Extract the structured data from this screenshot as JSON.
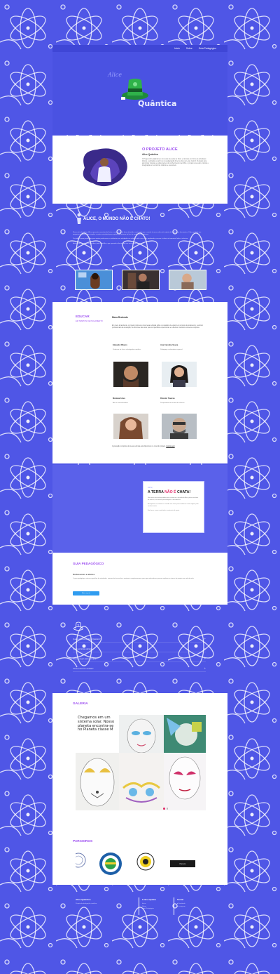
{
  "nav": {
    "items": [
      "Início",
      "Sobre",
      "Guia Pedagógico"
    ]
  },
  "hero": {
    "logo_alice": "Alice",
    "logo_quantica": "Quântica"
  },
  "projeto": {
    "title": "O PROJETO ALICE",
    "subtitle": "Alice Quântica",
    "text": "O Projeto Alice Quântica é uma série de aulas de física e ciências em forma de atividades lúdicas, realizadas a partir de uma adaptação livre da obra de Lewis Carroll. Pensado para aproximar crianças e adolescentes do conhecimento científico, o projeto une teatro, ciência e imaginação em encontros criativos e acessíveis."
  },
  "mundo": {
    "title": "ALICE, O MUNDO NÃO É CHATO!",
    "paragraphs": [
      "Nesta série de vídeos, Alice apresenta conceitos de física e astronomia de forma divertida, mostrando que o mundo à nossa volta está repleto de fenômenos fascinantes. Cada episódio traz perguntas, experimentos simples e muita curiosidade para explorar a natureza da luz, da matéria e do universo.",
      "Os vídeos foram produzidos para apoiar professores e estudantes nas atividades em sala de aula e em casa, ampliando o acesso à ciência de maneira lúdica e inclusiva.",
      "Assista aos episódios e descubra, junto com Alice, que aprender ciência pode ser uma grande aventura."
    ]
  },
  "educar": {
    "title": "EDUCAR",
    "subtitle": "EM TEMPOS DE ISOLAMENTO",
    "heading": "Mesa Redonda",
    "text": "Em meio à pandemia, o projeto promoveu uma mesa redonda sobre os desafios de educar em tempos de isolamento, reunindo profissionais da educação, da ciência e das artes para compartilhar experiências e reflexões. Assista à conversa completa.",
    "link_text": "Assista aqui",
    "professionals": [
      {
        "name": "Eduardo Ribeiro",
        "desc": "Professor de física e divulgador científico."
      },
      {
        "name": "Ana Carolina Souza",
        "desc": "Pedagoga e educadora especial."
      },
      {
        "name": "Mariana Alves",
        "desc": "Atriz e arte-educadora."
      },
      {
        "name": "Ricardo Tavares",
        "desc": "Pesquisador em ensino de ciências."
      }
    ],
    "footer": "A gravação completa da mesa redonda está disponível no canal do projeto."
  },
  "terra": {
    "small": "Alice,",
    "title_a": "A TERRA ",
    "title_hl": "NÃO É",
    "title_b": " CHATA!",
    "paragraphs": [
      "Uma nova série de episódios para continuar a jornada de Alice pelos mistérios da ciência, com novos personagens e descobertas.",
      "Acompanhe as estreias e convide sua turma para embarcar nesta viagem pelo conhecimento.",
      "Em breve, novos conteúdos e materiais de apoio."
    ]
  },
  "guia": {
    "title": "GUIA PEDAGÓGICO",
    "subtitle": "Professores e alunos",
    "text": "O guia pedagógico reúne sugestões de atividades, roteiros de discussão e materiais complementares para que educadores possam explorar os temas do projeto em sala de aula.",
    "button": "Baixe o guia"
  },
  "faq": {
    "items": [
      {
        "q": "Qual o objetivo do Alice Quântica?",
        "icon": "+"
      },
      {
        "q": "Quais as faixas etárias?",
        "icon": "+"
      },
      {
        "q": "Preciso pagar para participar?",
        "icon": "+"
      },
      {
        "q": "Como entrar em contato?",
        "icon": "+"
      }
    ]
  },
  "galeria": {
    "title": "GALERIA",
    "caption": "Chegamos em um sistema solar. Nosso planeta encontra-se no Planeta classe M",
    "partners_title": "PARCEIROS",
    "partner_last": "Parceiro"
  },
  "footer": {
    "col1_title": "Alice Quântica",
    "col1_text": "Projeto de divulgação científica",
    "col2_title": "Links rápidos",
    "col2_items": [
      "Início",
      "Sobre",
      "Guia Pedagógico"
    ],
    "col3_title": "Social",
    "col3_items": [
      "Facebook",
      "Instagram"
    ]
  },
  "colors": {
    "background": "#4f56e6",
    "accent_purple": "#9c4df0",
    "accent_pink": "#e1306c",
    "button_blue": "#2f9cf0"
  }
}
